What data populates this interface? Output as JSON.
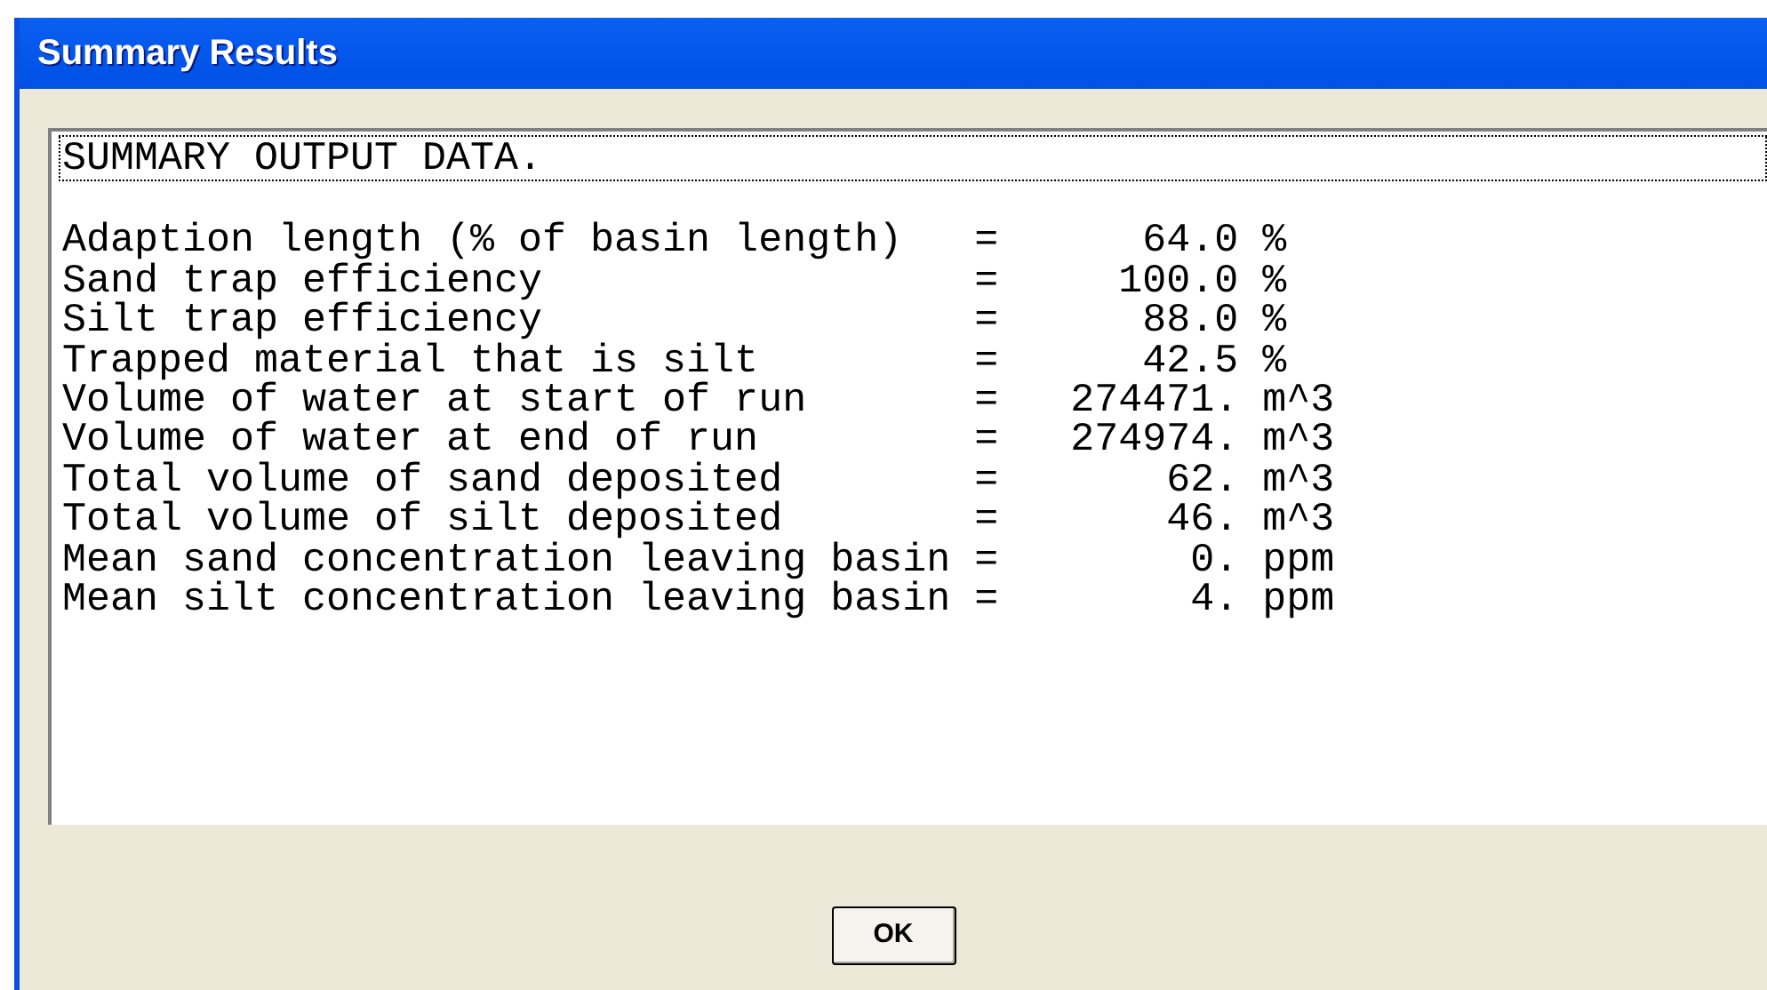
{
  "window": {
    "title": "Summary Results"
  },
  "output": {
    "heading": "SUMMARY OUTPUT DATA.",
    "lines": [
      "Adaption length (% of basin length)   =      64.0 %",
      "Sand trap efficiency                  =     100.0 %",
      "Silt trap efficiency                  =      88.0 %",
      "Trapped material that is silt         =      42.5 %",
      "Volume of water at start of run       =   274471. m^3",
      "Volume of water at end of run         =   274974. m^3",
      "Total volume of sand deposited        =       62. m^3",
      "Total volume of silt deposited        =       46. m^3",
      "Mean sand concentration leaving basin =        0. ppm",
      "Mean silt concentration leaving basin =        4. ppm"
    ]
  },
  "buttons": [
    {
      "label": "OK"
    }
  ]
}
